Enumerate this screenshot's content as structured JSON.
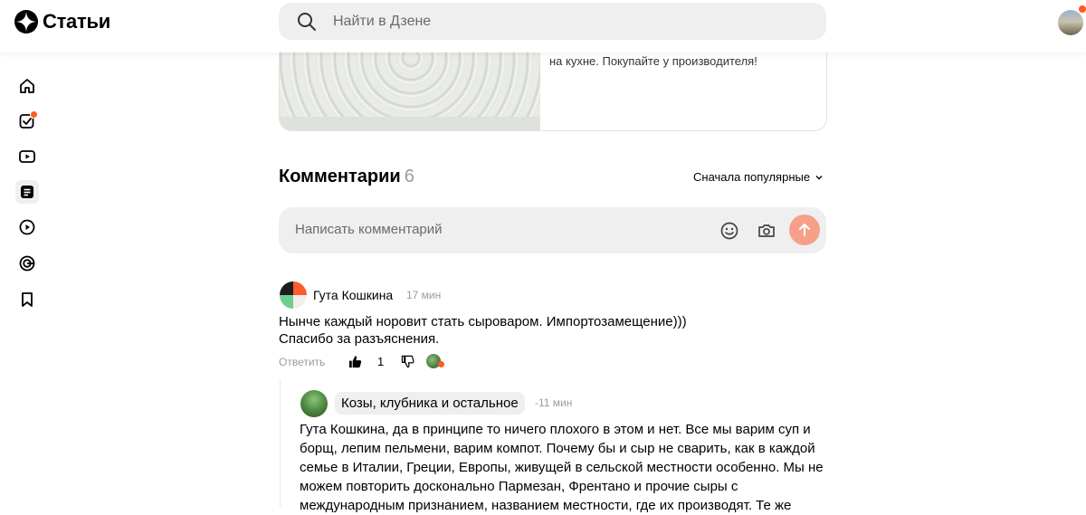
{
  "header": {
    "logo_text": "Статьи",
    "search_placeholder": "Найти в Дзене"
  },
  "sidebar": {
    "items": [
      {
        "name": "home",
        "icon": "home-icon"
      },
      {
        "name": "subscriptions",
        "icon": "checklist-icon",
        "has_notification": true
      },
      {
        "name": "videos",
        "icon": "video-icon"
      },
      {
        "name": "articles",
        "icon": "article-icon",
        "active": true
      },
      {
        "name": "shorts",
        "icon": "play-circle-icon"
      },
      {
        "name": "channels",
        "icon": "zen-icon"
      },
      {
        "name": "bookmarks",
        "icon": "bookmark-icon"
      }
    ]
  },
  "ad": {
    "text": "на кухне. Покупайте у производителя!"
  },
  "comments": {
    "title": "Комментарии",
    "count": "6",
    "sort_label": "Сначала популярные",
    "input_placeholder": "Написать комментарий",
    "items": [
      {
        "author": "Гута Кошкина",
        "time": "17 мин",
        "text_line1": "Нынче каждый норовит стать сыроваром. Импортозамещение)))",
        "text_line2": "Спасибо за разъяснения.",
        "reply_label": "Ответить",
        "likes": "1",
        "replies": [
          {
            "author": "Козы, клубника и остальное",
            "time": "-11 мин",
            "text": "Гута Кошкина, да в принципе то ничего плохого в этом и нет. Все мы варим суп и борщ, лепим пельмени, варим компот. Почему бы и сыр не сварить, как в каждой семье в Италии, Греции, Европы, живущей в сельской местности особенно. Мы не можем повторить досконально Пармезан, Френтано и прочие сыры с международным признанием, названием местности, где их производят. Те же"
          }
        ]
      }
    ]
  },
  "colors": {
    "accent": "#ff5a1f",
    "send_button": "#f6a089",
    "search_bg": "#efeff0",
    "muted_text": "#9a9a9a"
  }
}
